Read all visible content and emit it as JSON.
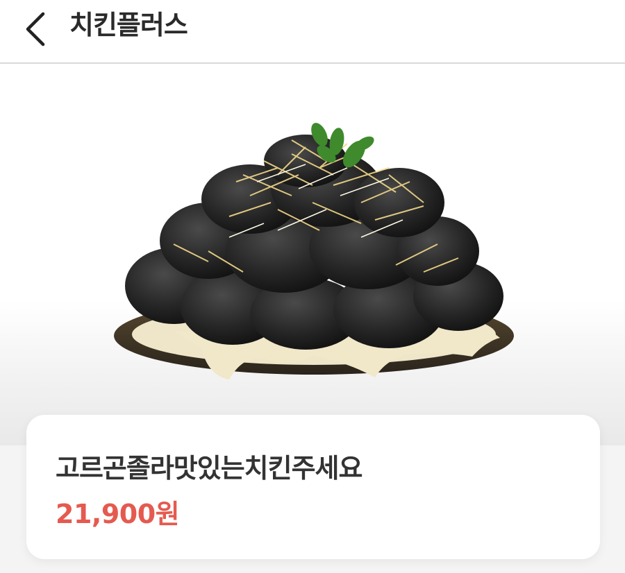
{
  "header": {
    "title": "치킨플러스",
    "back_icon": "chevron-left-icon"
  },
  "hero": {
    "image_subject": "chicken-dish-image"
  },
  "product": {
    "name": "고르곤졸라맛있는치킨주세요",
    "price": "21,900원"
  },
  "colors": {
    "price": "#e55a4f",
    "title": "#2a2a2a",
    "background": "#f4f4f4"
  }
}
